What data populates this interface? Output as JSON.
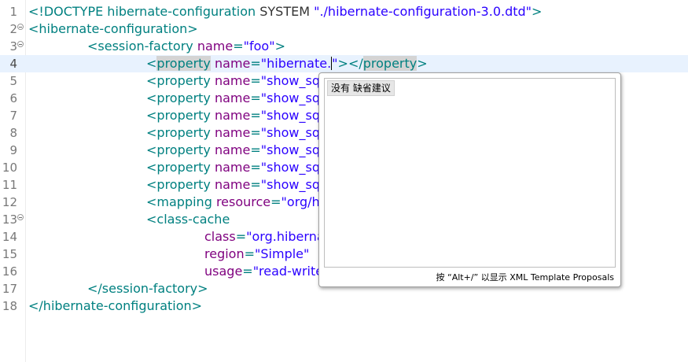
{
  "editor": {
    "lines": [
      {
        "num": "1",
        "fold": false,
        "current": false,
        "indent": 0,
        "tokens": [
          {
            "t": "br",
            "v": "<!DOCTYPE hibernate-configuration "
          },
          {
            "t": "txt",
            "v": "SYSTEM "
          },
          {
            "t": "str",
            "v": "\"./hibernate-configuration-3.0.dtd\""
          },
          {
            "t": "br",
            "v": ">"
          }
        ]
      },
      {
        "num": "2",
        "fold": true,
        "current": false,
        "indent": 0,
        "tokens": [
          {
            "t": "br",
            "v": "<hibernate-configuration>"
          }
        ]
      },
      {
        "num": "3",
        "fold": true,
        "current": false,
        "indent": 1,
        "tokens": [
          {
            "t": "br",
            "v": "<session-factory "
          },
          {
            "t": "attr",
            "v": "name"
          },
          {
            "t": "br",
            "v": "="
          },
          {
            "t": "str",
            "v": "\"foo\""
          },
          {
            "t": "br",
            "v": ">"
          }
        ]
      },
      {
        "num": "4",
        "fold": false,
        "current": true,
        "indent": 2,
        "tokens": [
          {
            "t": "br",
            "v": "<"
          },
          {
            "t": "hl",
            "v": "property"
          },
          {
            "t": "br",
            "v": " "
          },
          {
            "t": "attr",
            "v": "name"
          },
          {
            "t": "br",
            "v": "="
          },
          {
            "t": "str",
            "v": "\"hibernate."
          },
          {
            "t": "caret",
            "v": ""
          },
          {
            "t": "str",
            "v": "\""
          },
          {
            "t": "br",
            "v": "></"
          },
          {
            "t": "hl",
            "v": "property"
          },
          {
            "t": "br",
            "v": ">"
          }
        ]
      },
      {
        "num": "5",
        "fold": false,
        "current": false,
        "indent": 2,
        "tokens": [
          {
            "t": "br",
            "v": "<property "
          },
          {
            "t": "attr",
            "v": "name"
          },
          {
            "t": "br",
            "v": "="
          },
          {
            "t": "str",
            "v": "\"show_sql\""
          }
        ]
      },
      {
        "num": "6",
        "fold": false,
        "current": false,
        "indent": 2,
        "tokens": [
          {
            "t": "br",
            "v": "<property "
          },
          {
            "t": "attr",
            "v": "name"
          },
          {
            "t": "br",
            "v": "="
          },
          {
            "t": "str",
            "v": "\"show_sql\""
          }
        ]
      },
      {
        "num": "7",
        "fold": false,
        "current": false,
        "indent": 2,
        "tokens": [
          {
            "t": "br",
            "v": "<property "
          },
          {
            "t": "attr",
            "v": "name"
          },
          {
            "t": "br",
            "v": "="
          },
          {
            "t": "str",
            "v": "\"show_sql\""
          }
        ]
      },
      {
        "num": "8",
        "fold": false,
        "current": false,
        "indent": 2,
        "tokens": [
          {
            "t": "br",
            "v": "<property "
          },
          {
            "t": "attr",
            "v": "name"
          },
          {
            "t": "br",
            "v": "="
          },
          {
            "t": "str",
            "v": "\"show_sql\""
          }
        ]
      },
      {
        "num": "9",
        "fold": false,
        "current": false,
        "indent": 2,
        "tokens": [
          {
            "t": "br",
            "v": "<property "
          },
          {
            "t": "attr",
            "v": "name"
          },
          {
            "t": "br",
            "v": "="
          },
          {
            "t": "str",
            "v": "\"show_sql\""
          }
        ]
      },
      {
        "num": "10",
        "fold": false,
        "current": false,
        "indent": 2,
        "tokens": [
          {
            "t": "br",
            "v": "<property "
          },
          {
            "t": "attr",
            "v": "name"
          },
          {
            "t": "br",
            "v": "="
          },
          {
            "t": "str",
            "v": "\"show_sql\""
          }
        ]
      },
      {
        "num": "11",
        "fold": false,
        "current": false,
        "indent": 2,
        "tokens": [
          {
            "t": "br",
            "v": "<property "
          },
          {
            "t": "attr",
            "v": "name"
          },
          {
            "t": "br",
            "v": "="
          },
          {
            "t": "str",
            "v": "\"show_sql\""
          }
        ]
      },
      {
        "num": "12",
        "fold": false,
        "current": false,
        "indent": 2,
        "tokens": [
          {
            "t": "br",
            "v": "<mapping "
          },
          {
            "t": "attr",
            "v": "resource"
          },
          {
            "t": "br",
            "v": "="
          },
          {
            "t": "str",
            "v": "\"org/hib"
          }
        ]
      },
      {
        "num": "13",
        "fold": true,
        "current": false,
        "indent": 2,
        "tokens": [
          {
            "t": "br",
            "v": "<class-cache"
          }
        ]
      },
      {
        "num": "14",
        "fold": false,
        "current": false,
        "indent": 3,
        "tokens": [
          {
            "t": "attr",
            "v": "class"
          },
          {
            "t": "br",
            "v": "="
          },
          {
            "t": "str",
            "v": "\"org.hibernat"
          }
        ]
      },
      {
        "num": "15",
        "fold": false,
        "current": false,
        "indent": 3,
        "tokens": [
          {
            "t": "attr",
            "v": "region"
          },
          {
            "t": "br",
            "v": "="
          },
          {
            "t": "str",
            "v": "\"Simple\""
          }
        ]
      },
      {
        "num": "16",
        "fold": false,
        "current": false,
        "indent": 3,
        "tokens": [
          {
            "t": "attr",
            "v": "usage"
          },
          {
            "t": "br",
            "v": "="
          },
          {
            "t": "str",
            "v": "\"read-write\""
          }
        ]
      },
      {
        "num": "17",
        "fold": false,
        "current": false,
        "indent": 1,
        "tokens": [
          {
            "t": "br",
            "v": "</session-factory>"
          }
        ]
      },
      {
        "num": "18",
        "fold": false,
        "current": false,
        "indent": 0,
        "tokens": [
          {
            "t": "br",
            "v": "</hibernate-configuration>"
          }
        ]
      }
    ]
  },
  "popup": {
    "proposal": "没有 缺省建议",
    "status": "按 “Alt+/” 以显示 XML Template Proposals"
  },
  "colors": {
    "bracket": "#008080",
    "attribute": "#7f007f",
    "string": "#2a00ff",
    "current_line": "#e8f2fe",
    "occurrence_highlight": "#d4d4d4"
  }
}
